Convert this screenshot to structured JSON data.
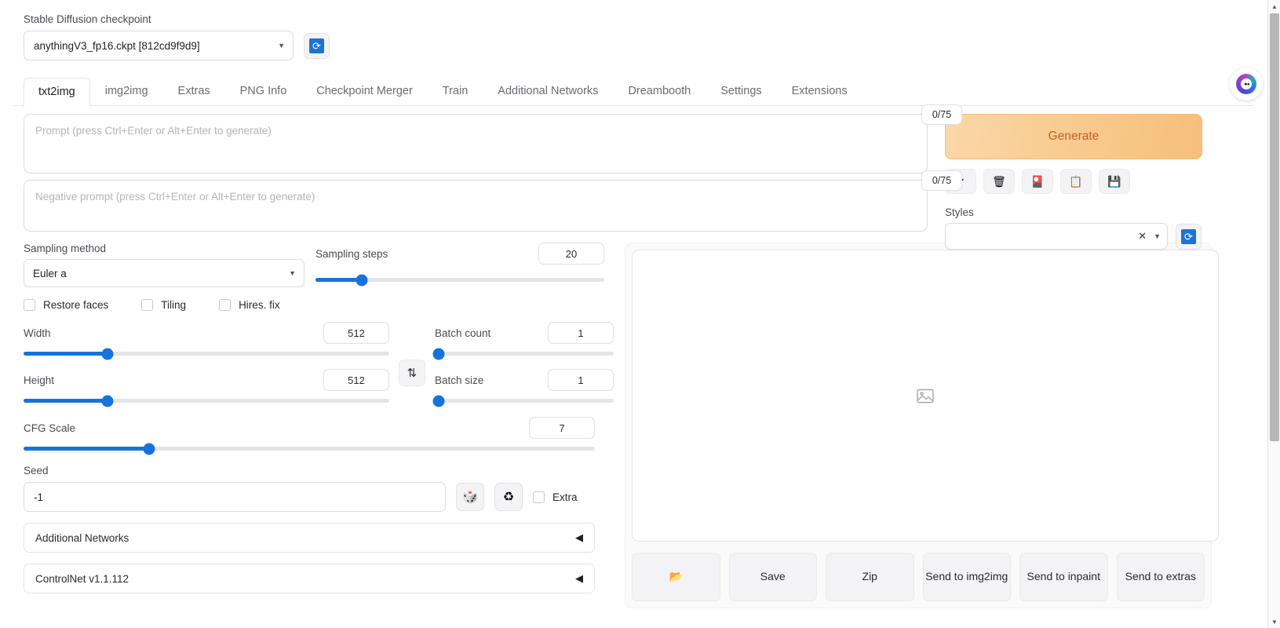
{
  "checkpoint": {
    "label": "Stable Diffusion checkpoint",
    "value": "anythingV3_fp16.ckpt [812cd9f9d9]",
    "caret": "▼",
    "refresh_icon": "⟳"
  },
  "tabs": [
    {
      "label": "txt2img",
      "active": true
    },
    {
      "label": "img2img",
      "active": false
    },
    {
      "label": "Extras",
      "active": false
    },
    {
      "label": "PNG Info",
      "active": false
    },
    {
      "label": "Checkpoint Merger",
      "active": false
    },
    {
      "label": "Train",
      "active": false
    },
    {
      "label": "Additional Networks",
      "active": false
    },
    {
      "label": "Dreambooth",
      "active": false
    },
    {
      "label": "Settings",
      "active": false
    },
    {
      "label": "Extensions",
      "active": false
    }
  ],
  "prompt": {
    "value": "",
    "placeholder": "Prompt (press Ctrl+Enter or Alt+Enter to generate)",
    "counter": "0/75"
  },
  "negative_prompt": {
    "value": "",
    "placeholder": "Negative prompt (press Ctrl+Enter or Alt+Enter to generate)",
    "counter": "0/75"
  },
  "generate": {
    "label": "Generate"
  },
  "tool_buttons": [
    {
      "name": "restore-progress-icon",
      "glyph": "↙"
    },
    {
      "name": "clear-prompt-icon",
      "glyph": "🗑"
    },
    {
      "name": "extra-networks-icon",
      "glyph": "🎴"
    },
    {
      "name": "apply-style-icon",
      "glyph": "📋"
    },
    {
      "name": "save-style-icon",
      "glyph": "💾"
    }
  ],
  "styles": {
    "label": "Styles",
    "value": "",
    "clear_glyph": "✕",
    "caret": "▼",
    "refresh_icon": "⟳"
  },
  "sampling": {
    "method_label": "Sampling method",
    "method_value": "Euler a",
    "steps_label": "Sampling steps",
    "steps_value": "20",
    "steps_percent": 16
  },
  "checkboxes": [
    {
      "label": "Restore faces",
      "checked": false
    },
    {
      "label": "Tiling",
      "checked": false
    },
    {
      "label": "Hires. fix",
      "checked": false
    }
  ],
  "dimensions": {
    "width_label": "Width",
    "width_value": "512",
    "width_percent": 23,
    "height_label": "Height",
    "height_value": "512",
    "height_percent": 23,
    "swap_glyph": "⇅"
  },
  "batch": {
    "count_label": "Batch count",
    "count_value": "1",
    "count_percent": 0,
    "size_label": "Batch size",
    "size_value": "1",
    "size_percent": 0
  },
  "cfg": {
    "label": "CFG Scale",
    "value": "7",
    "percent": 22
  },
  "seed": {
    "label": "Seed",
    "value": "-1",
    "dice_glyph": "🎲",
    "recycle_glyph": "♻",
    "extra_label": "Extra",
    "extra_checked": false
  },
  "accordions": [
    {
      "label": "Additional Networks",
      "chevron": "◀"
    },
    {
      "label": "ControlNet v1.1.112",
      "chevron": "◀"
    }
  ],
  "gallery": {
    "placeholder_icon": "image-placeholder"
  },
  "action_buttons": [
    {
      "label": "📂",
      "name": "open-folder-button"
    },
    {
      "label": "Save",
      "name": "save-button"
    },
    {
      "label": "Zip",
      "name": "zip-button"
    },
    {
      "label": "Send to img2img",
      "name": "send-to-img2img-button"
    },
    {
      "label": "Send to inpaint",
      "name": "send-to-inpaint-button"
    },
    {
      "label": "Send to extras",
      "name": "send-to-extras-button"
    }
  ],
  "float_badge": {
    "text": "●◂"
  },
  "scrollbar": {
    "up_glyph": "▲",
    "down_glyph": "▼"
  },
  "colors": {
    "accent_blue": "#1872db",
    "generate_orange": "#f6bf7b",
    "generate_text": "#c0622c"
  }
}
